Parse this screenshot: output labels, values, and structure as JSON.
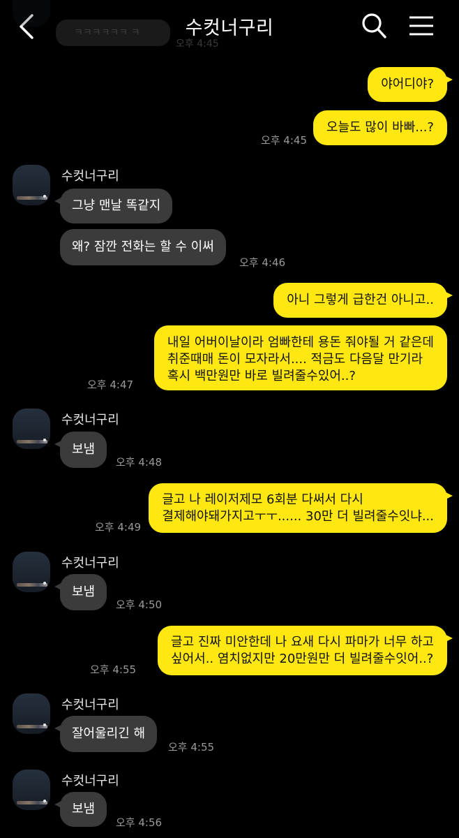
{
  "header": {
    "title": "수컷너구리"
  },
  "icons": {
    "back": "chevron-left-icon",
    "search": "search-icon",
    "menu": "hamburger-menu-icon"
  },
  "colors": {
    "my_bubble": "#ffe812",
    "their_bubble": "#3b3b3b",
    "background": "#000000",
    "time": "#9a9a9a"
  },
  "top_partial": {
    "text": "ㅋㅋㅋㅋㅋㅋ ㅋ",
    "time": "오후 4:45"
  },
  "messages": {
    "m1": {
      "text": "야어디야?"
    },
    "m2": {
      "text": "오늘도 많이 바빠...?",
      "time": "오후 4:45"
    },
    "g1": {
      "sender": "수컷너구리"
    },
    "m3": {
      "text": "그냥 맨날 똑같지"
    },
    "m4": {
      "text": "왜? 잠깐 전화는 할 수 이써",
      "time": "오후 4:46"
    },
    "m5": {
      "text": "아니 그렇게 급한건 아니고.."
    },
    "m6": {
      "lines": [
        "내일 어버이날이라 엄빠한테 용돈 줘야될 거 같은데",
        "취준때매 돈이 모자라서.... 적금도 다음달 만기라",
        "혹시 백만원만 바로 빌려줄수있어..?"
      ],
      "time": "오후 4:47"
    },
    "g2": {
      "sender": "수컷너구리"
    },
    "m7": {
      "text": "보냄",
      "time": "오후 4:48"
    },
    "m8": {
      "lines": [
        "글고 나 레이저제모 6회분 다써서 다시",
        "결제해야돼가지고ㅜㅜ...... 30만 더 빌려줄수잇냐..."
      ],
      "time": "오후 4:49"
    },
    "g3": {
      "sender": "수컷너구리"
    },
    "m9": {
      "text": "보냄",
      "time": "오후 4:50"
    },
    "m10": {
      "lines": [
        "글고 진짜 미안한데 나 요새 다시 파마가 너무 하고",
        "싶어서.. 염치없지만 20만원만 더 빌려줄수잇어..?"
      ],
      "time": "오후 4:55"
    },
    "g4": {
      "sender": "수컷너구리"
    },
    "m11": {
      "text": "잘어울리긴 해",
      "time": "오후 4:55"
    },
    "g5": {
      "sender": "수컷너구리"
    },
    "m12": {
      "text": "보냄",
      "time": "오후 4:56"
    }
  }
}
